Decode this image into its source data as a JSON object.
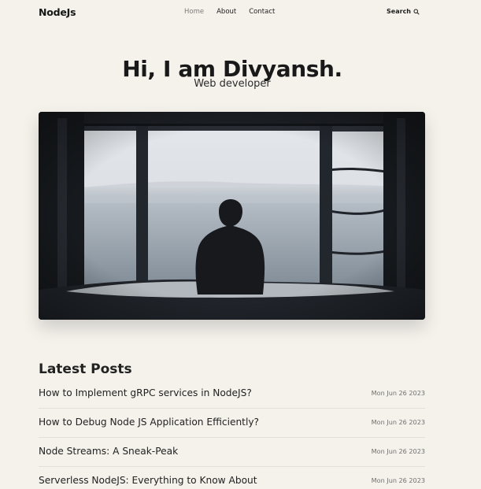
{
  "header": {
    "logo": "NodeJs",
    "nav": [
      {
        "label": "Home",
        "active": true
      },
      {
        "label": "About",
        "active": false
      },
      {
        "label": "Contact",
        "active": false
      }
    ],
    "search_label": "Search"
  },
  "hero": {
    "title": "Hi, I am Divyansh.",
    "subtitle": "Web developer"
  },
  "latest": {
    "title": "Latest Posts",
    "posts": [
      {
        "title": "How to Implement gRPC services in NodeJS?",
        "date": "Mon Jun 26 2023"
      },
      {
        "title": "How to Debug Node JS Application Efficiently?",
        "date": "Mon Jun 26 2023"
      },
      {
        "title": "Node Streams: A Sneak-Peak",
        "date": "Mon Jun 26 2023"
      },
      {
        "title": "Serverless NodeJS: Everything to Know About",
        "date": "Mon Jun 26 2023"
      }
    ]
  },
  "colors": {
    "background": "#f5f2ec",
    "text": "#1c1c1c",
    "nav_active": "#7b7b7b",
    "muted": "#6f6f6f"
  },
  "icons": {
    "search": "search-icon"
  }
}
